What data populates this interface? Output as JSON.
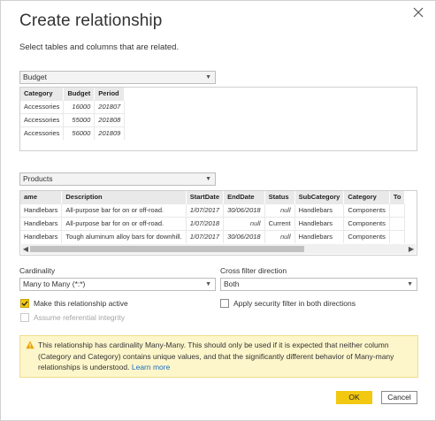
{
  "dialog": {
    "title": "Create relationship",
    "subtitle": "Select tables and columns that are related."
  },
  "table1": {
    "name": "Budget",
    "columns": [
      "Category",
      "Budget",
      "Period"
    ],
    "rows": [
      [
        "Accessories",
        "16000",
        "201807"
      ],
      [
        "Accessories",
        "55000",
        "201808"
      ],
      [
        "Accessories",
        "56000",
        "201809"
      ]
    ]
  },
  "table2": {
    "name": "Products",
    "columns": [
      "ame",
      "Description",
      "StartDate",
      "EndDate",
      "Status",
      "SubCategory",
      "Category",
      "To"
    ],
    "rows": [
      [
        "Handlebars",
        "All-purpose bar for on or off-road.",
        "1/07/2017",
        "30/06/2018",
        "null",
        "Handlebars",
        "Components",
        ""
      ],
      [
        "Handlebars",
        "All-purpose bar for on or off-road.",
        "1/07/2018",
        "null",
        "Current",
        "Handlebars",
        "Components",
        ""
      ],
      [
        "Handlebars",
        "Tough aluminum alloy bars for downhill.",
        "1/07/2017",
        "30/06/2018",
        "null",
        "Handlebars",
        "Components",
        ""
      ]
    ]
  },
  "cardinality": {
    "label": "Cardinality",
    "value": "Many to Many (*:*)"
  },
  "cross_filter": {
    "label": "Cross filter direction",
    "value": "Both"
  },
  "options": {
    "active_label": "Make this relationship active",
    "active_checked": true,
    "security_label": "Apply security filter in both directions",
    "security_checked": false,
    "referential_label": "Assume referential integrity",
    "referential_checked": false
  },
  "warning": {
    "text": "This relationship has cardinality Many-Many. This should only be used if it is expected that neither column (Category and Category) contains unique values, and that the significantly different behavior of Many-many relationships is understood.",
    "link": "Learn more"
  },
  "buttons": {
    "ok": "OK",
    "cancel": "Cancel"
  },
  "colors": {
    "accent": "#f2c811",
    "warning_bg": "#fdf6cb",
    "link": "#1b6ec2"
  },
  "icons": {
    "close": "close-icon",
    "dropdown": "chevron-down-icon",
    "warning": "warning-icon",
    "check": "check-icon"
  }
}
